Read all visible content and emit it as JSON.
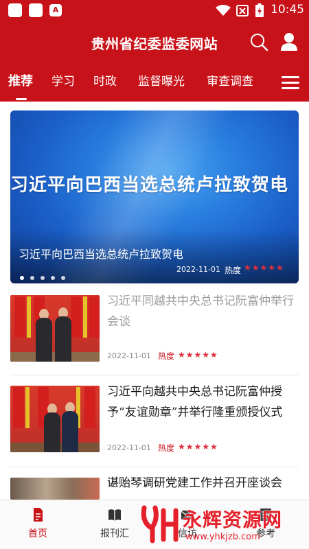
{
  "status_bar": {
    "time": "10:45",
    "icons": [
      "app-icon",
      "app-icon",
      "app-a-icon",
      "wifi-icon",
      "no-sim-icon",
      "battery-charging-icon"
    ]
  },
  "header": {
    "title": "贵州省纪委监委网站",
    "icons": [
      "search-icon",
      "user-icon"
    ]
  },
  "tabs": [
    {
      "label": "推荐",
      "active": true
    },
    {
      "label": "学习"
    },
    {
      "label": "时政"
    },
    {
      "label": "监督曝光"
    },
    {
      "label": "审查调查"
    }
  ],
  "banner": {
    "headline": "习近平向巴西当选总统卢拉致贺电",
    "caption": "习近平向巴西当选总统卢拉致贺电",
    "date": "2022-11-01",
    "heat_label": "热度",
    "stars": "★★★★★",
    "slide_count": 5
  },
  "articles": [
    {
      "title": "习近平同越共中央总书记阮富仲举行会谈",
      "date": "2022-11-01",
      "heat_label": "热度",
      "stars": "★★★★★",
      "read": true
    },
    {
      "title": "习近平向越共中央总书记阮富仲授予“友谊勋章”并举行隆重颁授仪式",
      "date": "2022-11-01",
      "heat_label": "热度",
      "stars": "★★★★★",
      "read": false
    },
    {
      "title": "谌贻琴调研党建工作并召开座谈会",
      "read": false
    }
  ],
  "bottom_nav": [
    {
      "label": "首页",
      "icon": "document-icon",
      "active": true
    },
    {
      "label": "报刊汇",
      "icon": "book-icon"
    },
    {
      "label": "信访",
      "icon": "mail-icon"
    },
    {
      "label": "参考",
      "icon": "list-icon"
    }
  ],
  "watermark": {
    "text": "永辉资源网",
    "url": "www.yhkjzb.com"
  },
  "colors": {
    "brand_red": "#c8121a",
    "banner_blue": "#2b7fe0",
    "star_red": "#e0303a"
  }
}
